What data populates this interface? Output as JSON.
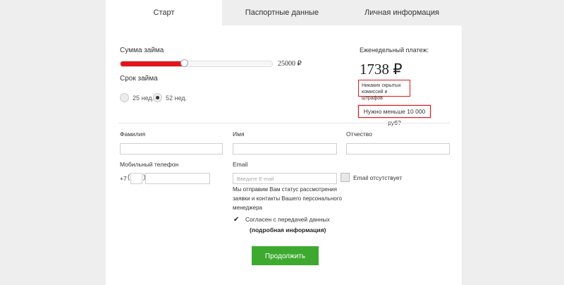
{
  "tabs": [
    {
      "label": "Старт",
      "active": true
    },
    {
      "label": "Паспортные данные",
      "active": false
    },
    {
      "label": "Личная информация",
      "active": false
    }
  ],
  "loan": {
    "amount_label": "Сумма займа",
    "amount_value": "25000 ₽",
    "amount_fraction": 0.42,
    "term_label": "Срок займа",
    "term_options": [
      {
        "label": "25 нед.",
        "selected": false
      },
      {
        "label": "52 нед.",
        "selected": true
      }
    ]
  },
  "payment": {
    "weekly_label": "Еженедельный платеж:",
    "weekly_value": "1738 ₽",
    "note": "Никаких скрытых комиссий и штрафов",
    "need_less": "Нужно меньше 10 000 руб?"
  },
  "form": {
    "surname_label": "Фамилия",
    "name_label": "Имя",
    "patronymic_label": "Отчество",
    "phone_label": "Мобильный телефон",
    "phone_prefix": "+7",
    "email_label": "Email",
    "email_placeholder": "Введите E-mail",
    "email_absent_label": "Email отсутствует",
    "email_note": "Мы отправим Вам статус рассмотрения заявки и контакты Вашего персонального менеджера"
  },
  "consent": {
    "checked": true,
    "text": "Согласен с передачей данных",
    "details_link": "(подробная информация)"
  },
  "continue_button": "Продолжить",
  "colors": {
    "accent_red": "#e3151b",
    "button_green": "#3daa2f"
  }
}
